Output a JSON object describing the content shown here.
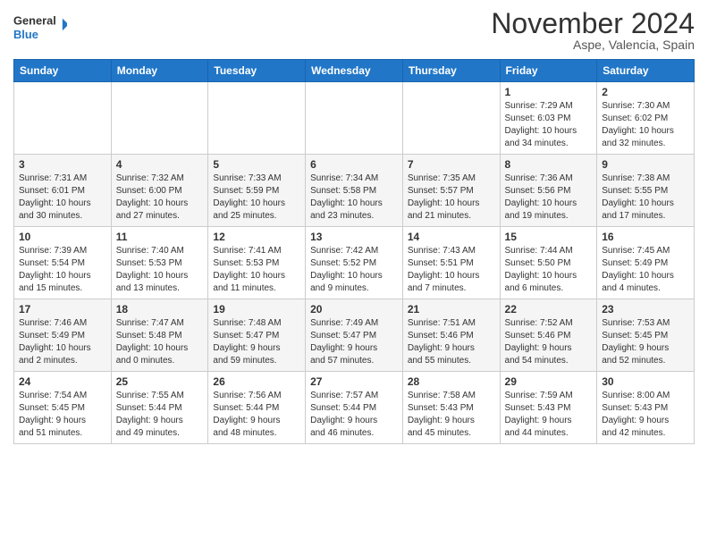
{
  "header": {
    "logo_line1": "General",
    "logo_line2": "Blue",
    "month": "November 2024",
    "location": "Aspe, Valencia, Spain"
  },
  "weekdays": [
    "Sunday",
    "Monday",
    "Tuesday",
    "Wednesday",
    "Thursday",
    "Friday",
    "Saturday"
  ],
  "rows": [
    [
      {
        "day": "",
        "info": ""
      },
      {
        "day": "",
        "info": ""
      },
      {
        "day": "",
        "info": ""
      },
      {
        "day": "",
        "info": ""
      },
      {
        "day": "",
        "info": ""
      },
      {
        "day": "1",
        "info": "Sunrise: 7:29 AM\nSunset: 6:03 PM\nDaylight: 10 hours\nand 34 minutes."
      },
      {
        "day": "2",
        "info": "Sunrise: 7:30 AM\nSunset: 6:02 PM\nDaylight: 10 hours\nand 32 minutes."
      }
    ],
    [
      {
        "day": "3",
        "info": "Sunrise: 7:31 AM\nSunset: 6:01 PM\nDaylight: 10 hours\nand 30 minutes."
      },
      {
        "day": "4",
        "info": "Sunrise: 7:32 AM\nSunset: 6:00 PM\nDaylight: 10 hours\nand 27 minutes."
      },
      {
        "day": "5",
        "info": "Sunrise: 7:33 AM\nSunset: 5:59 PM\nDaylight: 10 hours\nand 25 minutes."
      },
      {
        "day": "6",
        "info": "Sunrise: 7:34 AM\nSunset: 5:58 PM\nDaylight: 10 hours\nand 23 minutes."
      },
      {
        "day": "7",
        "info": "Sunrise: 7:35 AM\nSunset: 5:57 PM\nDaylight: 10 hours\nand 21 minutes."
      },
      {
        "day": "8",
        "info": "Sunrise: 7:36 AM\nSunset: 5:56 PM\nDaylight: 10 hours\nand 19 minutes."
      },
      {
        "day": "9",
        "info": "Sunrise: 7:38 AM\nSunset: 5:55 PM\nDaylight: 10 hours\nand 17 minutes."
      }
    ],
    [
      {
        "day": "10",
        "info": "Sunrise: 7:39 AM\nSunset: 5:54 PM\nDaylight: 10 hours\nand 15 minutes."
      },
      {
        "day": "11",
        "info": "Sunrise: 7:40 AM\nSunset: 5:53 PM\nDaylight: 10 hours\nand 13 minutes."
      },
      {
        "day": "12",
        "info": "Sunrise: 7:41 AM\nSunset: 5:53 PM\nDaylight: 10 hours\nand 11 minutes."
      },
      {
        "day": "13",
        "info": "Sunrise: 7:42 AM\nSunset: 5:52 PM\nDaylight: 10 hours\nand 9 minutes."
      },
      {
        "day": "14",
        "info": "Sunrise: 7:43 AM\nSunset: 5:51 PM\nDaylight: 10 hours\nand 7 minutes."
      },
      {
        "day": "15",
        "info": "Sunrise: 7:44 AM\nSunset: 5:50 PM\nDaylight: 10 hours\nand 6 minutes."
      },
      {
        "day": "16",
        "info": "Sunrise: 7:45 AM\nSunset: 5:49 PM\nDaylight: 10 hours\nand 4 minutes."
      }
    ],
    [
      {
        "day": "17",
        "info": "Sunrise: 7:46 AM\nSunset: 5:49 PM\nDaylight: 10 hours\nand 2 minutes."
      },
      {
        "day": "18",
        "info": "Sunrise: 7:47 AM\nSunset: 5:48 PM\nDaylight: 10 hours\nand 0 minutes."
      },
      {
        "day": "19",
        "info": "Sunrise: 7:48 AM\nSunset: 5:47 PM\nDaylight: 9 hours\nand 59 minutes."
      },
      {
        "day": "20",
        "info": "Sunrise: 7:49 AM\nSunset: 5:47 PM\nDaylight: 9 hours\nand 57 minutes."
      },
      {
        "day": "21",
        "info": "Sunrise: 7:51 AM\nSunset: 5:46 PM\nDaylight: 9 hours\nand 55 minutes."
      },
      {
        "day": "22",
        "info": "Sunrise: 7:52 AM\nSunset: 5:46 PM\nDaylight: 9 hours\nand 54 minutes."
      },
      {
        "day": "23",
        "info": "Sunrise: 7:53 AM\nSunset: 5:45 PM\nDaylight: 9 hours\nand 52 minutes."
      }
    ],
    [
      {
        "day": "24",
        "info": "Sunrise: 7:54 AM\nSunset: 5:45 PM\nDaylight: 9 hours\nand 51 minutes."
      },
      {
        "day": "25",
        "info": "Sunrise: 7:55 AM\nSunset: 5:44 PM\nDaylight: 9 hours\nand 49 minutes."
      },
      {
        "day": "26",
        "info": "Sunrise: 7:56 AM\nSunset: 5:44 PM\nDaylight: 9 hours\nand 48 minutes."
      },
      {
        "day": "27",
        "info": "Sunrise: 7:57 AM\nSunset: 5:44 PM\nDaylight: 9 hours\nand 46 minutes."
      },
      {
        "day": "28",
        "info": "Sunrise: 7:58 AM\nSunset: 5:43 PM\nDaylight: 9 hours\nand 45 minutes."
      },
      {
        "day": "29",
        "info": "Sunrise: 7:59 AM\nSunset: 5:43 PM\nDaylight: 9 hours\nand 44 minutes."
      },
      {
        "day": "30",
        "info": "Sunrise: 8:00 AM\nSunset: 5:43 PM\nDaylight: 9 hours\nand 42 minutes."
      }
    ]
  ]
}
